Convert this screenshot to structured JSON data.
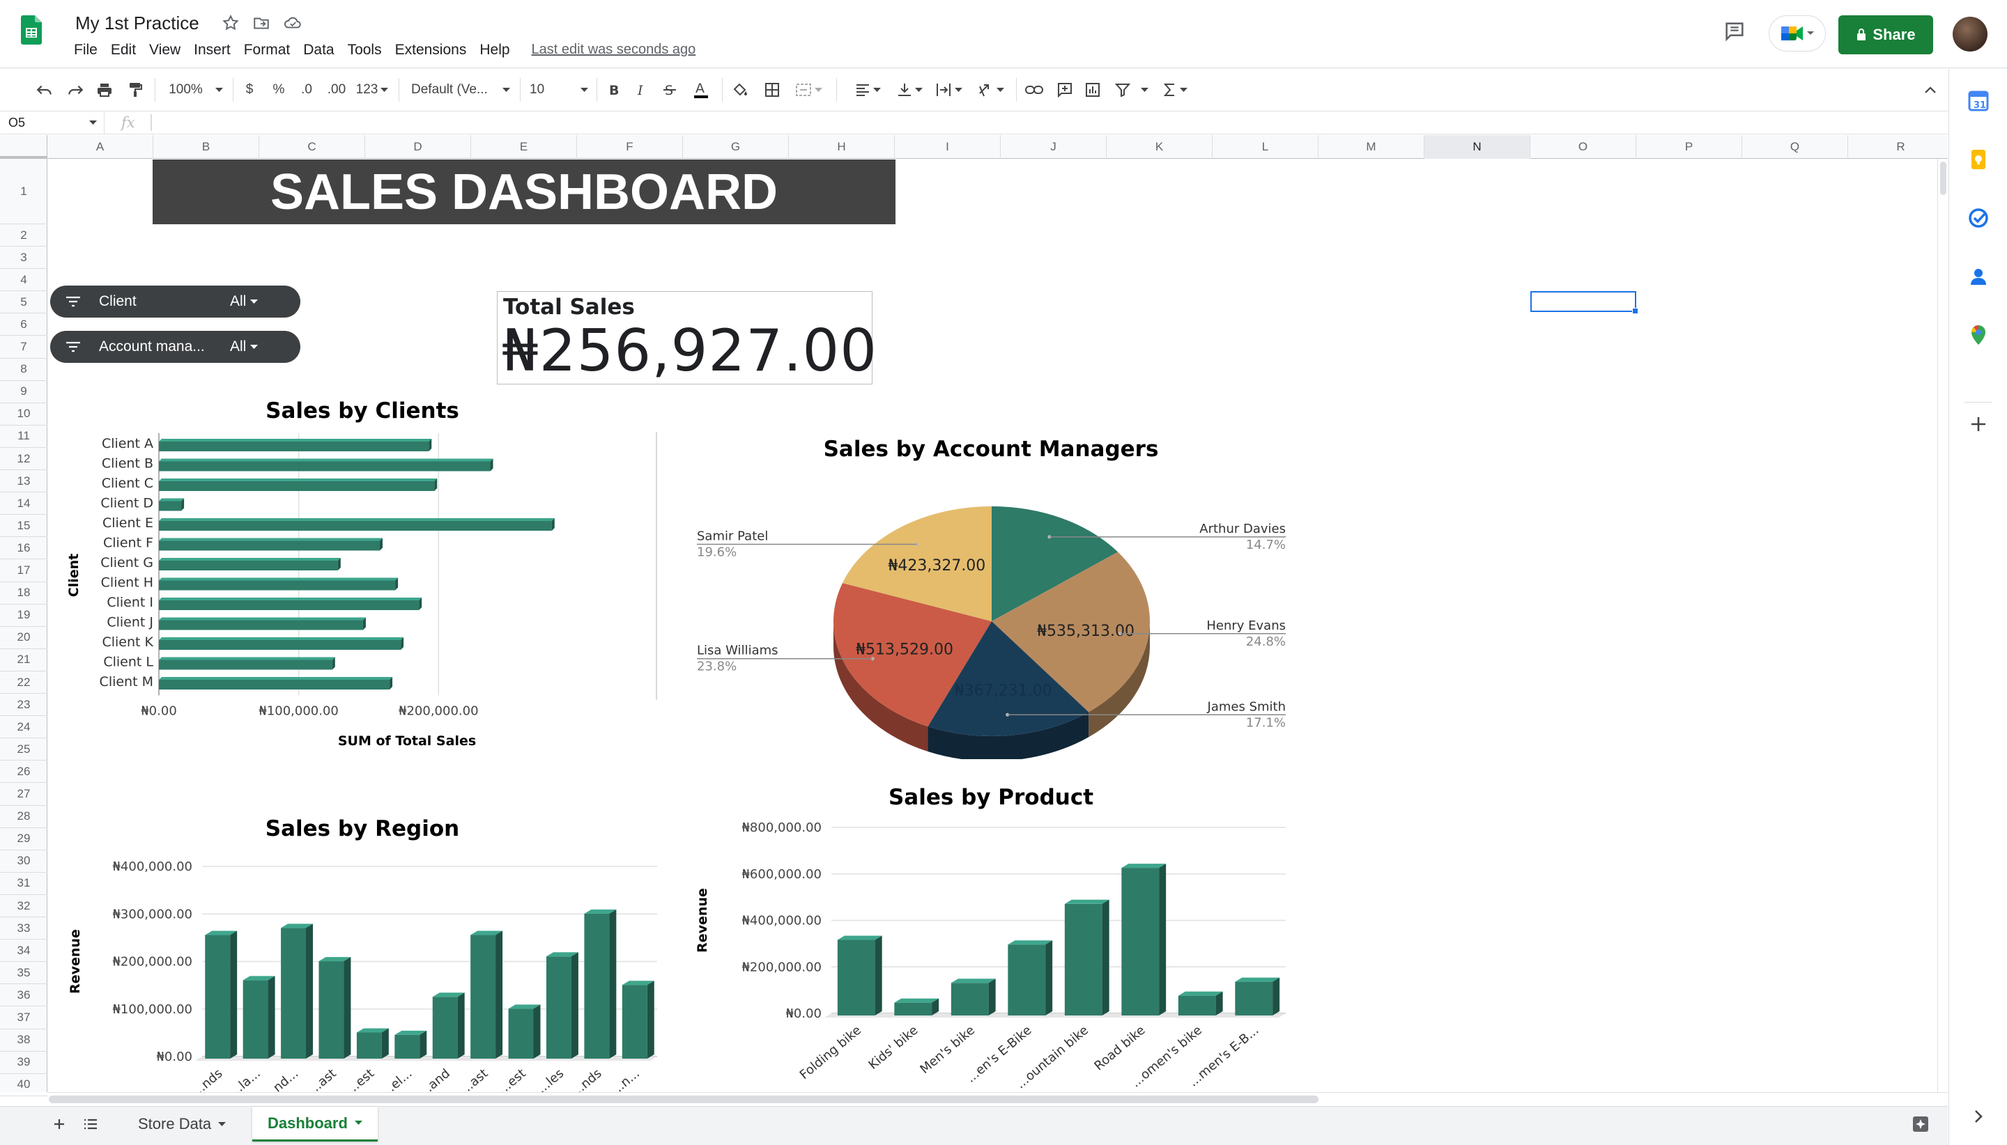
{
  "document": {
    "title": "My 1st Practice",
    "last_edit": "Last edit was seconds ago"
  },
  "menu": [
    "File",
    "Edit",
    "View",
    "Insert",
    "Format",
    "Data",
    "Tools",
    "Extensions",
    "Help"
  ],
  "share_label": "Share",
  "toolbar": {
    "zoom": "100%",
    "currency": "$",
    "percent": "%",
    "dec_less": ".0",
    "dec_more": ".00",
    "number_format": "123",
    "font": "Default (Ve...",
    "font_size": "10"
  },
  "formula_bar": {
    "cell_ref": "O5",
    "fx": "fx",
    "content": ""
  },
  "columns": [
    "A",
    "B",
    "C",
    "D",
    "E",
    "F",
    "G",
    "H",
    "I",
    "J",
    "K",
    "L",
    "M",
    "N",
    "O",
    "P",
    "Q",
    "R"
  ],
  "selected_column": "N",
  "rows": [
    "1",
    "2",
    "3",
    "4",
    "5",
    "6",
    "7",
    "8",
    "9",
    "10",
    "11",
    "12",
    "13",
    "14",
    "15",
    "16",
    "17",
    "18",
    "19",
    "20",
    "21",
    "22",
    "23",
    "24",
    "25",
    "26",
    "27",
    "28",
    "29",
    "30",
    "31",
    "32",
    "33",
    "34",
    "35",
    "36",
    "37",
    "38",
    "39",
    "40"
  ],
  "dashboard": {
    "title": "SALES DASHBOARD",
    "filters": [
      {
        "label": "Client",
        "value": "All"
      },
      {
        "label": "Account mana...",
        "value": "All"
      }
    ],
    "total_sales": {
      "label": "Total Sales",
      "value": "₦256,927.00"
    }
  },
  "chart_data": [
    {
      "type": "bar",
      "orientation": "horizontal",
      "title": "Sales by Clients",
      "xlabel": "SUM of Total Sales",
      "ylabel": "Client",
      "categories": [
        "Client A",
        "Client B",
        "Client C",
        "Client D",
        "Client E",
        "Client F",
        "Client G",
        "Client H",
        "Client I",
        "Client J",
        "Client K",
        "Client L",
        "Client M"
      ],
      "values": [
        193000,
        237000,
        197000,
        16000,
        281000,
        158000,
        128000,
        169000,
        186000,
        146000,
        173000,
        124000,
        165000
      ],
      "xlim": [
        0,
        300000
      ],
      "ticks": [
        "₦0.00",
        "₦100,000.00",
        "₦200,000.00"
      ],
      "color": "#2e7b68"
    },
    {
      "type": "pie",
      "title": "Sales by Account Managers",
      "slices": [
        {
          "label": "Arthur Davies",
          "percent": "14.7%",
          "value": 14.7,
          "color": "#2e7b68"
        },
        {
          "label": "Henry Evans",
          "percent": "24.8%",
          "value": 24.8,
          "color": "#b78a5e",
          "data_label": "₦535,313.00"
        },
        {
          "label": "James Smith",
          "percent": "17.1%",
          "value": 17.1,
          "color": "#1a3d57",
          "data_label": "₦367,231.00"
        },
        {
          "label": "Lisa Williams",
          "percent": "23.8%",
          "value": 23.8,
          "color": "#cb5b46",
          "data_label": "₦513,529.00"
        },
        {
          "label": "Samir Patel",
          "percent": "19.6%",
          "value": 19.6,
          "color": "#e4bc6c",
          "data_label": "₦423,327.00"
        }
      ]
    },
    {
      "type": "bar",
      "title": "Sales by Region",
      "ylabel": "Revenue",
      "categories": [
        "...nds",
        "...la...",
        "...nd...",
        "...ast",
        "...est",
        "...el...",
        "...and",
        "...ast",
        "...est",
        "...les",
        "...nds",
        "...n..."
      ],
      "values": [
        260000,
        165000,
        275000,
        205000,
        55000,
        50000,
        130000,
        260000,
        105000,
        215000,
        305000,
        155000
      ],
      "ylim": [
        0,
        400000
      ],
      "ticks": [
        "₦0.00",
        "₦100,000.00",
        "₦200,000.00",
        "₦300,000.00",
        "₦400,000.00"
      ],
      "color": "#2e7b68"
    },
    {
      "type": "bar",
      "title": "Sales by Product",
      "ylabel": "Revenue",
      "categories": [
        "Folding bike",
        "Kids' bike",
        "Men's bike",
        "...en's E-Bike",
        "...ountain bike",
        "Road bike",
        "...omen's bike",
        "...men's E-B..."
      ],
      "values": [
        325000,
        55000,
        140000,
        305000,
        480000,
        635000,
        85000,
        145000
      ],
      "ylim": [
        0,
        800000
      ],
      "ticks": [
        "₦0.00",
        "₦200,000.00",
        "₦400,000.00",
        "₦600,000.00",
        "₦800,000.00"
      ],
      "color": "#2e7b68"
    }
  ],
  "sheet_tabs": [
    {
      "label": "Store Data",
      "active": false
    },
    {
      "label": "Dashboard",
      "active": true
    }
  ]
}
